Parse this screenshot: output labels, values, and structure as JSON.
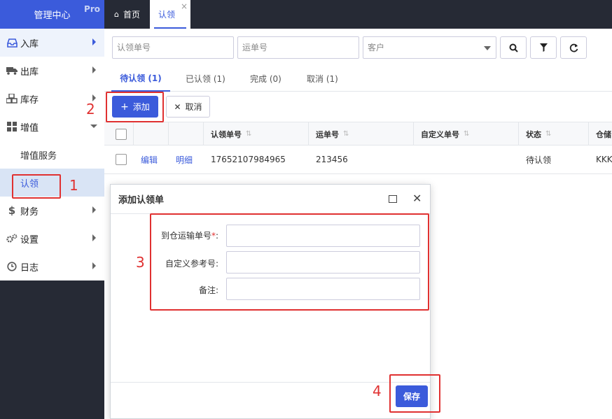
{
  "brand": {
    "title": "管理中心",
    "badge": "Pro"
  },
  "sidebar": {
    "items": [
      {
        "label": "入库",
        "icon": "inbox-icon"
      },
      {
        "label": "出库",
        "icon": "truck-icon"
      },
      {
        "label": "库存",
        "icon": "cubes-icon"
      },
      {
        "label": "增值",
        "icon": "grid-icon"
      },
      {
        "label": "增值服务"
      },
      {
        "label": "认领"
      },
      {
        "label": "财务",
        "icon": "dollar-icon"
      },
      {
        "label": "设置",
        "icon": "gears-icon"
      },
      {
        "label": "日志",
        "icon": "clock-icon"
      }
    ]
  },
  "tabs": [
    {
      "label": "首页"
    },
    {
      "label": "认领",
      "close": "×"
    }
  ],
  "search": {
    "claim_no_placeholder": "认领单号",
    "waybill_placeholder": "运单号",
    "customer_placeholder": "客户"
  },
  "status_tabs": [
    {
      "label": "待认领 (1)"
    },
    {
      "label": "已认领 (1)"
    },
    {
      "label": "完成 (0)"
    },
    {
      "label": "取消 (1)"
    }
  ],
  "actions": {
    "add": "添加",
    "cancel": "取消"
  },
  "table": {
    "headers": [
      "认领单号",
      "运单号",
      "自定义单号",
      "状态",
      "仓储"
    ],
    "rows": [
      {
        "edit": "编辑",
        "detail": "明细",
        "claim_no": "17652107984965",
        "waybill": "213456",
        "custom_no": "",
        "status": "待认领",
        "warehouse": "KKK"
      }
    ]
  },
  "modal": {
    "title": "添加认领单",
    "fields": [
      {
        "label": "到仓运输单号",
        "required": "*",
        "suffix": ":"
      },
      {
        "label": "自定义参考号:"
      },
      {
        "label": "备注:"
      }
    ],
    "save": "保存"
  },
  "annotations": [
    "1",
    "2",
    "3",
    "4"
  ],
  "colors": {
    "accent": "#3b5bdb",
    "sidebar_dark": "#262a35",
    "annotation": "#e03131"
  }
}
